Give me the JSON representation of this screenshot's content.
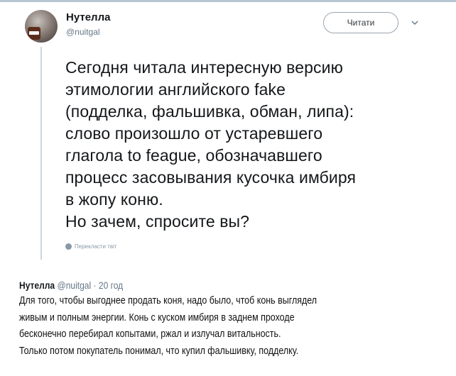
{
  "tweet": {
    "display_name": "Нутелла",
    "handle": "@nuitgal",
    "follow_label": "Читати",
    "lines": [
      "Сегодня читала интересную версию",
      "этимологии английского fake",
      "(подделка, фальшивка, обман, липа):",
      "слово произошло от устаревшего",
      "глагола to feague, обозначавшего",
      "процесс засовывания кусочка имбиря",
      "в жопу коню.",
      "Но зачем, спросите вы?"
    ],
    "translate_label": "Перекласти твіт"
  },
  "reply": {
    "display_name": "Нутелла",
    "meta": "@nuitgal · 20 год",
    "lines": [
      "Для того, чтобы выгоднее продать коня, надо было, чтоб конь выглядел",
      "живым и полным энергии. Конь с куском имбиря в заднем проходе",
      "бесконечно перебирал копытами, ржал и излучал витальность.",
      "Только потом покупатель понимал, что купил фальшивку, подделку."
    ]
  },
  "colors": {
    "text": "#14171a",
    "secondary": "#657786",
    "thread_line": "#ccd6dd"
  },
  "icons": {
    "menu": "chevron-down-icon",
    "translate": "globe-icon"
  }
}
